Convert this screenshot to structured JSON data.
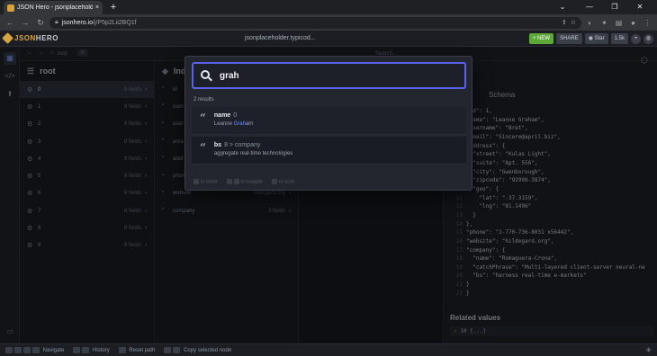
{
  "browser": {
    "tab_title": "JSON Hero - jsonplaceholder.typ...",
    "tab_close": "×",
    "new_tab": "+",
    "url_host": "jsonhero.io",
    "url_path": "/j/P5p2Lii2BQ1f",
    "window_controls": [
      "⌄",
      "—",
      "❐",
      "✕"
    ]
  },
  "header": {
    "logo_json": "JSON",
    "logo_hero": "HERO",
    "doc_title": "jsonplaceholder.typicod...",
    "new_label": "+ NEW",
    "share_label": "SHARE",
    "star_label": "Star",
    "star_count": "1.5k"
  },
  "subbar": {
    "crumb": "root",
    "tab_index": "0",
    "search_hint": "Search..."
  },
  "col1": {
    "title": "root",
    "rows": [
      {
        "key": "0",
        "value": "8 fields"
      },
      {
        "key": "1",
        "value": "8 fields"
      },
      {
        "key": "2",
        "value": "8 fields"
      },
      {
        "key": "3",
        "value": "8 fields"
      },
      {
        "key": "4",
        "value": "8 fields"
      },
      {
        "key": "5",
        "value": "8 fields"
      },
      {
        "key": "6",
        "value": "8 fields"
      },
      {
        "key": "7",
        "value": "8 fields"
      },
      {
        "key": "8",
        "value": "8 fields"
      },
      {
        "key": "9",
        "value": "8 fields"
      }
    ]
  },
  "col2": {
    "title": "Ind",
    "rows": [
      {
        "key": "id",
        "value": ""
      },
      {
        "key": "nam",
        "value": ""
      },
      {
        "key": "user",
        "value": ""
      },
      {
        "key": "ema",
        "value": ""
      },
      {
        "key": "addr",
        "value": ""
      },
      {
        "key": "phon",
        "value": ""
      },
      {
        "key": "website",
        "value": "hildegard.org"
      },
      {
        "key": "company",
        "value": "3 fields"
      }
    ]
  },
  "right": {
    "node": "0",
    "schema_tab": "Schema",
    "line_numbers": [
      "1",
      "2",
      "3",
      "4",
      "5",
      "6",
      "7",
      "8",
      "9",
      "10",
      "11",
      "12",
      "13",
      "14",
      "15",
      "16",
      "17",
      "18",
      "19",
      "20",
      "21",
      "22"
    ],
    "code_lines": [
      "\"id\": 1,",
      "\"name\": \"Leanne Graham\",",
      "\"username\": \"Bret\",",
      "\"email\": \"Sincere@april.biz\",",
      "\"address\": {",
      "  \"street\": \"Kulas Light\",",
      "  \"suite\": \"Apt. 556\",",
      "  \"city\": \"Gwenborough\",",
      "  \"zipcode\": \"92998-3874\",",
      "  \"geo\": {",
      "    \"lat\": \"-37.3159\",",
      "    \"lng\": \"81.1496\"",
      "  }",
      "},",
      "\"phone\": \"1-770-736-8031 x56442\",",
      "\"website\": \"hildegard.org\",",
      "\"company\": {",
      "  \"name\": \"Romaguera-Crona\",",
      "  \"catchPhrase\": \"Multi-layered client-server neural-ne",
      "  \"bs\": \"harness real-time e-markets\"",
      "}",
      "}"
    ],
    "related_title": "Related values",
    "related_item": "› 10  {...}"
  },
  "bottom": {
    "navigate": "Navigate",
    "history": "History",
    "reset": "Reset path",
    "copy": "Copy selected node"
  },
  "search": {
    "query": "grah",
    "result_count": "2 results",
    "results": [
      {
        "key": "name",
        "path": "0",
        "pre": "Leanne ",
        "hl": "Grah",
        "post": "am"
      },
      {
        "key": "bs",
        "path": "8 > company",
        "pre": "aggregate real-time technologies",
        "hl": "",
        "post": ""
      }
    ],
    "foot_select": "to select",
    "foot_navigate": "to navigate",
    "foot_close": "to close"
  },
  "colors": {
    "accent": "#5a62e8",
    "new_button": "#5ca93a",
    "highlight": "#6b8cff",
    "logo": "#d6a43c"
  }
}
